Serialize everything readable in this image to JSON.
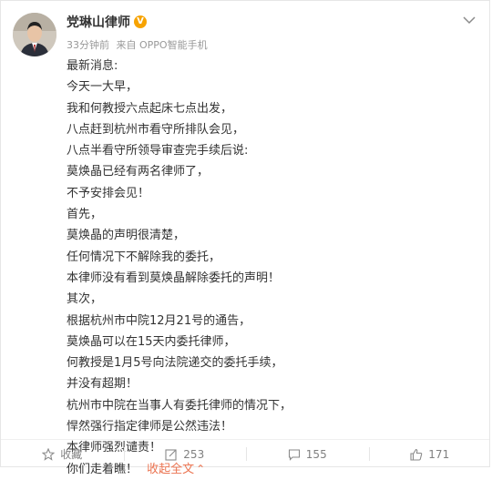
{
  "author": {
    "name": "党琳山律师",
    "verified_badge": "V",
    "avatar_icon": "portrait-avatar"
  },
  "meta": {
    "time": "33分钟前",
    "source": "来自 OPPO智能手机"
  },
  "post": {
    "lines": [
      "最新消息:",
      "今天一大早，",
      "我和何教授六点起床七点出发，",
      "八点赶到杭州市看守所排队会见，",
      "八点半看守所领导审查完手续后说:",
      "莫焕晶已经有两名律师了，",
      "不予安排会见！",
      "首先，",
      "莫焕晶的声明很清楚，",
      "任何情况下不解除我的委托，",
      "本律师没有看到莫焕晶解除委托的声明！",
      "其次，",
      "根据杭州市中院12月21号的通告，",
      "莫焕晶可以在15天内委托律师，",
      "何教授是1月5号向法院递交的委托手续，",
      "并没有超期！",
      "杭州市中院在当事人有委托律师的情况下，",
      "悍然强行指定律师是公然违法！",
      "本律师强烈谴责！"
    ],
    "last_line": "你们走着瞧！",
    "collapse_label": "收起全文",
    "collapse_caret": "⌃"
  },
  "actions": {
    "favorite_label": "收藏",
    "repost_count": "253",
    "comment_count": "155",
    "like_count": "171"
  },
  "colors": {
    "link": "#eb7350",
    "muted": "#999999",
    "verified": "#f7a300"
  }
}
